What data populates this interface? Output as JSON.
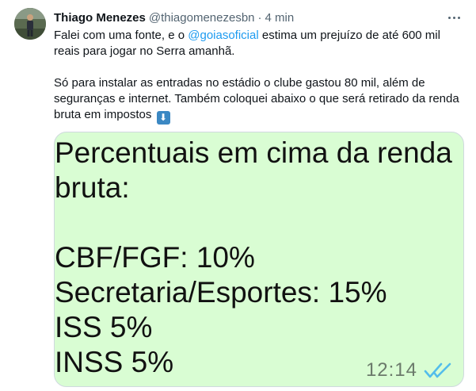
{
  "author": {
    "name": "Thiago Menezes",
    "handle": "@thiagomenezesbn",
    "separator": "·",
    "time": "4 min"
  },
  "tweet": {
    "line1_before": "Falei com uma fonte, e o ",
    "mention": "@goiasoficial",
    "line1_after": " estima um prejuízo de até 600 mil reais para jogar no Serra amanhã.",
    "paragraph2": "Só para instalar as entradas no estádio o clube gastou 80 mil, além de seguranças e internet. Também coloquei abaixo o que será retirado da renda bruta em impostos",
    "emoji": "⬇"
  },
  "media": {
    "lines": [
      "Percentuais em cima da renda",
      "bruta:",
      "",
      "CBF/FGF: 10%",
      "Secretaria/Esportes: 15%",
      "ISS 5%",
      "INSS 5%"
    ],
    "timestamp": "12:14"
  },
  "colors": {
    "accent": "#1d9bf0",
    "message_bg": "#d9fdd3",
    "read_ticks": "#53bdeb"
  },
  "icons": {
    "more": "more-horizontal-icon",
    "emoji": "down-arrow-emoji-icon",
    "ticks": "double-check-icon"
  }
}
